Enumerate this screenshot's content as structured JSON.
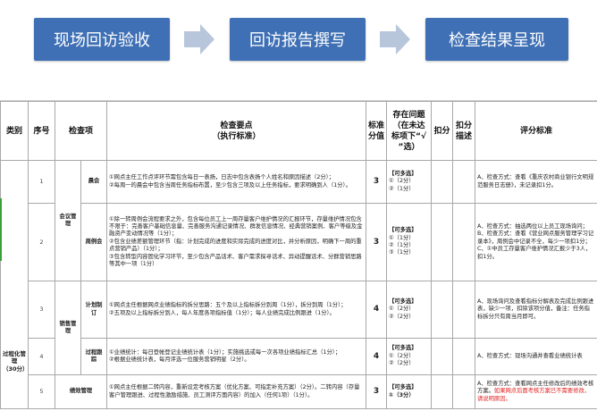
{
  "flow": {
    "steps": [
      "现场回访验收",
      "回访报告撰写",
      "检查结果呈现"
    ],
    "step_color": "#3f70b5",
    "arrow_color": "#b8c6dc"
  },
  "table": {
    "headers": {
      "category": "类别",
      "seq": "序号",
      "item": "检查项",
      "points_title": "检查要点",
      "points_sub": "（执行标准）",
      "score_l1": "标准",
      "score_l2": "分值",
      "issue_l1": "存在问题",
      "issue_l2": "（在未达",
      "issue_l3": "标项下“√",
      "issue_l4": "”选）",
      "deduct": "扣分",
      "deduct_desc_l1": "扣分",
      "deduct_desc_l2": "描述",
      "criteria": "评分标准"
    },
    "category_name_l1": "过程化管",
    "category_name_l2": "理",
    "category_score": "（30分）",
    "group_meeting": "会议管理",
    "group_sales": "销售管理",
    "rows": [
      {
        "seq": "1",
        "sub": "晨会",
        "points": "①网点主任工作点评环节需包含每日一表扬，日志中包含表扬个人姓名和原因描述（2分）；\n②每周一的晨会中包含当周任务指标布置，至少包含三项及以上任务指标，要求明确到人（1分）。",
        "score": "3",
        "issue_title": "【可多选】",
        "issues": [
          "①（2分）",
          "②（1分）"
        ],
        "criteria": "A、检查方式：查看《重庆农村商业银行文明规范服务日志册》，未记录扣1分。",
        "criteria_red": ""
      },
      {
        "seq": "2",
        "sub": "周例会",
        "points": "①除一转周例会流程要求之外，包含每位员工上一周存量客户维护情况的汇报环节，存量维护情况包含不限于：完善客户基础信息量、完善服务沟通记录情况、群发信息情况、经典营销案例、客户等级及金融资产变动情况等（1分）；\n②包含业绩差额管理环节（指：计划完成的进度和实际完成的进度对比，并分析原因，明确下一周的重点营销产品）（1分）；\n③包含转型内容固化学习环节，至少包含产品话术、客户需求探寻话术、异动提醒话术、分群营销思路等其中一项（1分）",
        "score": "3",
        "issue_title": "【可多选】",
        "issues": [
          "①（1分）",
          "②（1分）",
          "③（1分）"
        ],
        "criteria": "A、检查方式：抽选两位以上员工现场询问；B、检查方式：查看《营业网点服务管理学习记录本》，周例会中记录不全，每少一项扣1分；C、①中员工存量客户维护情况汇报少于3人，扣1分。",
        "criteria_red": ""
      },
      {
        "seq": "3",
        "sub": "计划制订",
        "points": "①网点主任根据网点业绩指标的拆分思路：五个及以上指标拆分到周（1分），拆分到周（1分）；\n②五项及以上指标拆分到人，每人年度各项指标值（1分）；每人业绩完成比例跟进（1分）。",
        "score": "4",
        "issue_title": "【可多选】",
        "issues": [
          "①（2分）",
          "②（2分）"
        ],
        "criteria": "A、现场询问及查看指标分解表及完成比例跟进表，缺少一项，扣除该项分值，备注：任务指标拆分只有周当月即可。",
        "criteria_red": ""
      },
      {
        "seq": "4",
        "sub": "过程跟踪",
        "points": "①业绩统计：每日登帐登记业绩统计表（1分）；实施挑选或每一次各项业绩指标汇总（1分）；\n②根据业绩统计表，每月评选一位服务营销明星（2分）。",
        "score": "4",
        "issue_title": "【可多选】",
        "issues": [
          "①（2分）",
          "②（2分）"
        ],
        "criteria": "A、检查方式：现场沟通并查看业绩统计表",
        "criteria_red": ""
      },
      {
        "seq": "5",
        "sub": "绩效管理",
        "points": "①网点主任根据二转内容，重新设定考核方案（优化方案、可指定补充方案）（2分）。二转内容（存量客户管理跟进、过程性激励措施、员工测评方面内容）的加入（任何1项）（1分）。",
        "score": "3",
        "issue_title": "【可多选】",
        "issues": [
          "①（3分）"
        ],
        "criteria": "A、检查方式：查看网点主任修改后的绩效考核方案。",
        "criteria_red": "如果网点后面考核方案已不需要修改，请说明原因。"
      }
    ]
  }
}
